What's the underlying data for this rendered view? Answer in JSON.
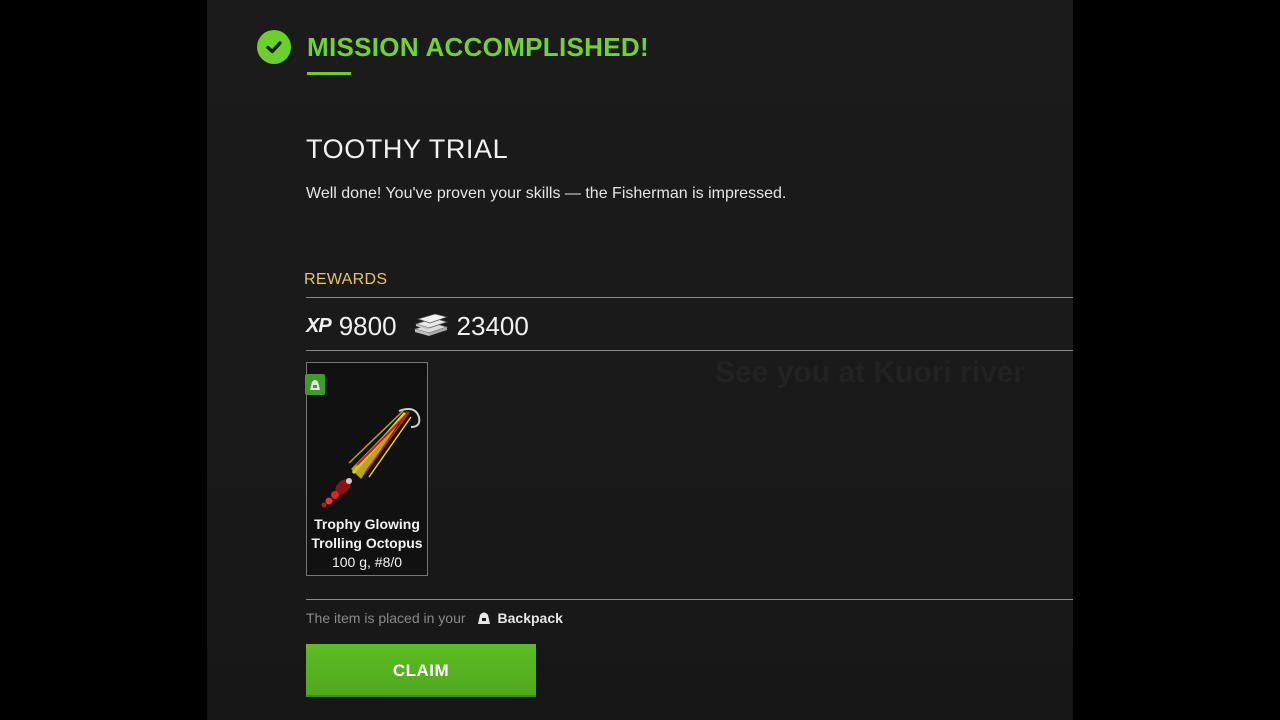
{
  "status": {
    "title": "MISSION ACCOMPLISHED!",
    "icon": "check-circle-icon",
    "color": "#6bd12a"
  },
  "mission": {
    "title": "TOOTHY TRIAL",
    "description": "Well done! You've proven your skills — the Fisherman is impressed."
  },
  "rewards": {
    "label": "REWARDS",
    "xp_label": "XP",
    "xp_value": "9800",
    "money_icon": "money-stack-icon",
    "money_value": "23400",
    "items": [
      {
        "name": "Trophy Glowing Trolling Octopus",
        "spec": "100 g, #8/0",
        "icon": "octopus-lure-icon",
        "badge_icon": "backpack-icon"
      }
    ]
  },
  "placement": {
    "text": "The item is placed in your",
    "location_icon": "backpack-icon",
    "location": "Backpack"
  },
  "claim_button": {
    "label": "CLAIM",
    "color": "#5dbd22"
  },
  "background_text": "See you at Kuori river"
}
